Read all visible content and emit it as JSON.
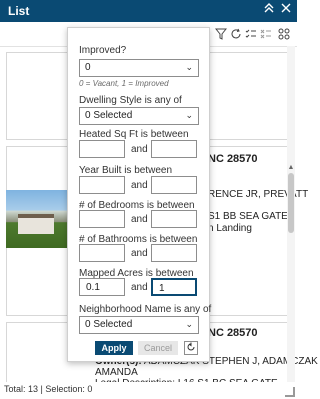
{
  "header": {
    "title": "List",
    "collapse_icon": "chevron-double-up-icon",
    "close_icon": "close-icon"
  },
  "toolbar": {
    "icons": [
      "filter-icon",
      "refresh-icon",
      "list-check-icon",
      "list-clear-icon",
      "grid-icon"
    ]
  },
  "cards": [
    {
      "address": "NC 28570",
      "line1": "RENCE JR, PREVATT",
      "line2": "S1 BB SEA GATE",
      "line3": "n Landing"
    },
    {
      "address": "NC 28570",
      "owner_label": "Owner(s):",
      "owner_value": "ADAMCZAK STEPHEN J, ADAMCZAK",
      "owner_value2": "AMANDA",
      "legal": "Legal Description: L16 S1 BC SEA GATE"
    }
  ],
  "footer": {
    "total": "Total: 13 | Selection: 0"
  },
  "filter": {
    "improved_label": "Improved?",
    "improved_value": "0",
    "improved_hint": "0 = Vacant, 1 = Improved",
    "dwelling_label": "Dwelling Style is any of",
    "dwelling_value": "0 Selected",
    "heated_label": "Heated Sq Ft is between",
    "year_label": "Year Built is between",
    "bedrooms_label": "# of Bedrooms is between",
    "bathrooms_label": "# of Bathrooms is between",
    "acres_label": "Mapped Acres is between",
    "acres_min": "0.1",
    "acres_max": "1",
    "neighborhood_label": "Neighborhood Name is any of",
    "neighborhood_value": "0 Selected",
    "and_text": "and",
    "apply_label": "Apply",
    "cancel_label": "Cancel",
    "reset_icon": "reset-icon"
  },
  "colors": {
    "header_bg": "#0a4a73",
    "accent": "#0a4a73"
  }
}
